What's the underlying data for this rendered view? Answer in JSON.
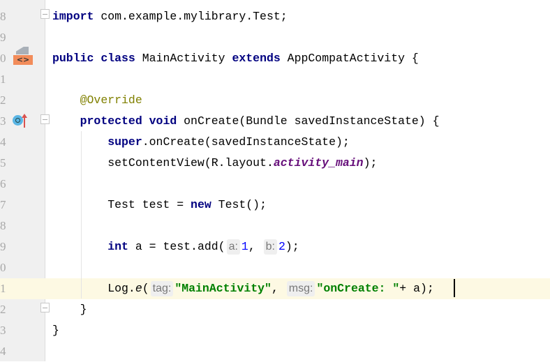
{
  "gutter_line_numbers": [
    "8",
    "9",
    "0",
    "1",
    "2",
    "3",
    "4",
    "5",
    "6",
    "7",
    "8",
    "9",
    "0",
    "1",
    "2",
    "3",
    "4"
  ],
  "current_line_index": 13,
  "colors": {
    "keyword": "#000080",
    "annotation": "#808000",
    "string": "#008000",
    "number": "#0000ff",
    "field": "#660e7a",
    "current_line": "#fdf9e3"
  },
  "gutter_icons": [
    {
      "line_index": 2,
      "icon": "layout-file-icon"
    },
    {
      "line_index": 5,
      "icon": "override-method-icon"
    }
  ],
  "lines": [
    [
      {
        "t": "import",
        "c": "kw"
      },
      {
        "t": " com.example.mylibrary.Test;"
      }
    ],
    [],
    [
      {
        "t": "public",
        "c": "kw"
      },
      {
        "t": " "
      },
      {
        "t": "class",
        "c": "kw"
      },
      {
        "t": " MainActivity "
      },
      {
        "t": "extends",
        "c": "kw"
      },
      {
        "t": " AppCompatActivity {"
      }
    ],
    [],
    [
      {
        "t": "    "
      },
      {
        "t": "@Override",
        "c": "ann"
      }
    ],
    [
      {
        "t": "    "
      },
      {
        "t": "protected",
        "c": "kw"
      },
      {
        "t": " "
      },
      {
        "t": "void",
        "c": "kw"
      },
      {
        "t": " onCreate(Bundle savedInstanceState) {"
      }
    ],
    [
      {
        "t": "        "
      },
      {
        "t": "super",
        "c": "kw"
      },
      {
        "t": ".onCreate(savedInstanceState);"
      }
    ],
    [
      {
        "t": "        setContentView(R.layout."
      },
      {
        "t": "activity_main",
        "c": "field"
      },
      {
        "t": ");"
      }
    ],
    [],
    [
      {
        "t": "        Test test = "
      },
      {
        "t": "new",
        "c": "kw"
      },
      {
        "t": " Test();"
      }
    ],
    [],
    [
      {
        "t": "        "
      },
      {
        "t": "int",
        "c": "kw"
      },
      {
        "t": " a = test.add("
      },
      {
        "t": "a:",
        "c": "hint"
      },
      {
        "t": "1",
        "c": "num"
      },
      {
        "t": ", "
      },
      {
        "t": "b:",
        "c": "hint"
      },
      {
        "t": "2",
        "c": "num"
      },
      {
        "t": ");"
      }
    ],
    [],
    [
      {
        "t": "        Log."
      },
      {
        "t": "e",
        "c": "static"
      },
      {
        "t": "("
      },
      {
        "t": "tag:",
        "c": "hint"
      },
      {
        "t": "\"MainActivity\"",
        "c": "str"
      },
      {
        "t": ", "
      },
      {
        "t": "msg:",
        "c": "hint"
      },
      {
        "t": "\"onCreate: \"",
        "c": "str"
      },
      {
        "t": "+ a);"
      }
    ],
    [
      {
        "t": "    }"
      }
    ],
    [
      {
        "t": "}"
      }
    ],
    []
  ]
}
